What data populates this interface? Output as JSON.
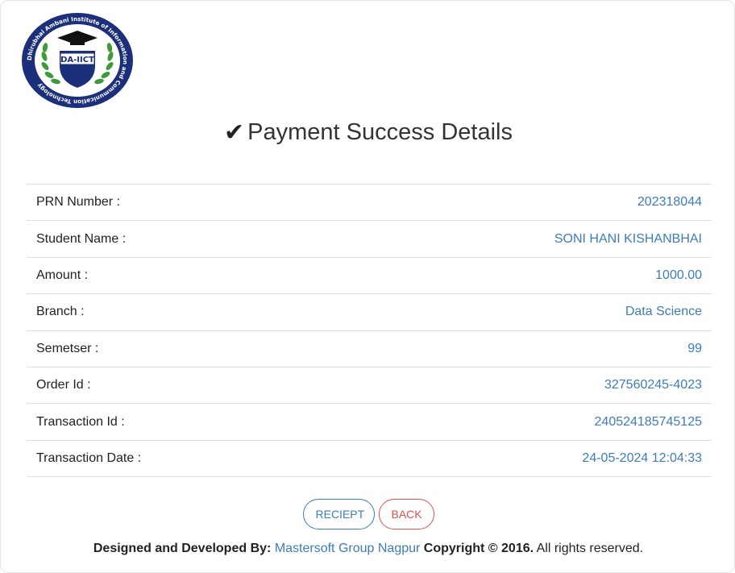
{
  "logo": {
    "emblem_text": "DA-IICT",
    "ring_text": "Dhirubhai Ambani Institute of Information and Communication Technology"
  },
  "header": {
    "title": "Payment Success Details"
  },
  "details": [
    {
      "label": "PRN Number :",
      "value": "202318044"
    },
    {
      "label": "Student Name :",
      "value": "SONI HANI KISHANBHAI"
    },
    {
      "label": "Amount :",
      "value": "1000.00"
    },
    {
      "label": "Branch :",
      "value": "Data Science"
    },
    {
      "label": "Semetser :",
      "value": "99"
    },
    {
      "label": "Order Id :",
      "value": "327560245-4023"
    },
    {
      "label": "Transaction Id :",
      "value": "240524185745125"
    },
    {
      "label": "Transaction Date :",
      "value": "24-05-2024 12:04:33"
    }
  ],
  "buttons": {
    "receipt_label": "RECIEPT",
    "back_label": "BACK"
  },
  "footer": {
    "designed_by": "Designed and Developed By:",
    "company": "Mastersoft Group Nagpur",
    "copyright": "Copyright © 2016.",
    "rights": "All rights reserved."
  },
  "colors": {
    "accent": "#3e7cb8",
    "danger": "#d9534f",
    "logo_navy": "#1c2f7a",
    "logo_green": "#3f9a3a"
  }
}
